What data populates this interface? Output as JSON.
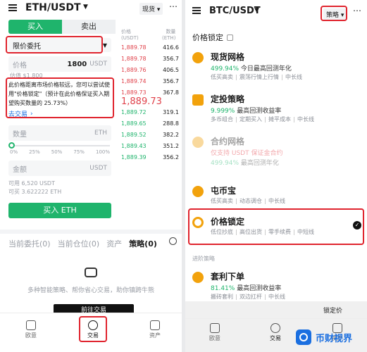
{
  "left": {
    "pair": "ETH/USDT",
    "price_source": "现货",
    "interval": "0.01",
    "tabs": {
      "buy": "买入",
      "sell": "卖出"
    },
    "order_type": "限价委托",
    "price": {
      "label": "价格",
      "value": "1800",
      "unit": "USDT",
      "est": "估值 $1,800"
    },
    "warning": {
      "text": "此价格距离市场价格较远，您可以尝试使用\"价格锁定\"（预计在此价格保证买入期望购买数量的 25.73%）",
      "link": "去交易"
    },
    "qty": {
      "label": "数量",
      "unit": "ETH"
    },
    "slider_marks": [
      "0%",
      "25%",
      "50%",
      "75%",
      "100%"
    ],
    "amount": {
      "label": "金额",
      "unit": "USDT"
    },
    "available": {
      "usdt": "可用 6,520 USDT",
      "eth": "可买 3.622222 ETH"
    },
    "buy_button": "买入 ETH",
    "orderbook": {
      "header_price": "价格\n(USDT)",
      "header_qty": "数量\n(ETH)",
      "asks": [
        {
          "price": "1,889.78",
          "qty": "416.6"
        },
        {
          "price": "1,889.78",
          "qty": "356.7"
        },
        {
          "price": "1,889.76",
          "qty": "406.5"
        },
        {
          "price": "1,889.74",
          "qty": "356.7"
        },
        {
          "price": "1,889.73",
          "qty": "367.8"
        }
      ],
      "last": "1,889.73",
      "bids": [
        {
          "price": "1,889.72",
          "qty": "319.1"
        },
        {
          "price": "1,889.65",
          "qty": "288.8"
        },
        {
          "price": "1,889.52",
          "qty": "382.2"
        },
        {
          "price": "1,889.43",
          "qty": "351.2"
        },
        {
          "price": "1,889.39",
          "qty": "356.2"
        }
      ]
    },
    "bottom_tabs": [
      "当前委托(0)",
      "当前仓位(0)",
      "资产",
      "策略(0)"
    ],
    "empty_text": "多种智能策略、帮你省心交易，助你镇跨牛熊",
    "empty_btn": "前往交易",
    "nav": [
      "欧意",
      "交易",
      "资产"
    ]
  },
  "right": {
    "pair": "BTC/USDT",
    "strategy_btn": "策略",
    "section_title": "价格锁定",
    "items": [
      {
        "title": "现货网格",
        "stat": "499.94%",
        "stat_label": "今日最高回测年化",
        "tags": [
          "低买高卖",
          "震荡行情上行情",
          "中长线"
        ]
      },
      {
        "title": "定投策略",
        "stat": "9.999%",
        "stat_label": "最高回测收益率",
        "tags": [
          "多币组合",
          "定期买入",
          "摊平成本",
          "中长线"
        ]
      },
      {
        "title": "合约网格",
        "stat": "仅支持 USDT 保证金合约",
        "stat_label": "",
        "tags": [
          "499.94%",
          "最高回测年化"
        ]
      },
      {
        "title": "屯币宝",
        "stat": "",
        "stat_label": "",
        "tags": [
          "低买高卖",
          "动态调仓",
          "中长线"
        ]
      },
      {
        "title": "价格锁定",
        "stat": "",
        "stat_label": "",
        "tags": [
          "低位抄底",
          "高位出货",
          "零手续费",
          "中短线"
        ]
      }
    ],
    "advanced_label": "进阶策略",
    "advanced_item": {
      "title": "套利下单",
      "stat": "81.41%",
      "stat_label": "最高回测收益率",
      "tags": [
        "搬砖套利",
        "双边扛杆",
        "中长线"
      ]
    },
    "lock_price_label": "锁定价",
    "nav": [
      "欧意",
      "交易",
      "资产"
    ]
  },
  "watermark": "币财视界"
}
